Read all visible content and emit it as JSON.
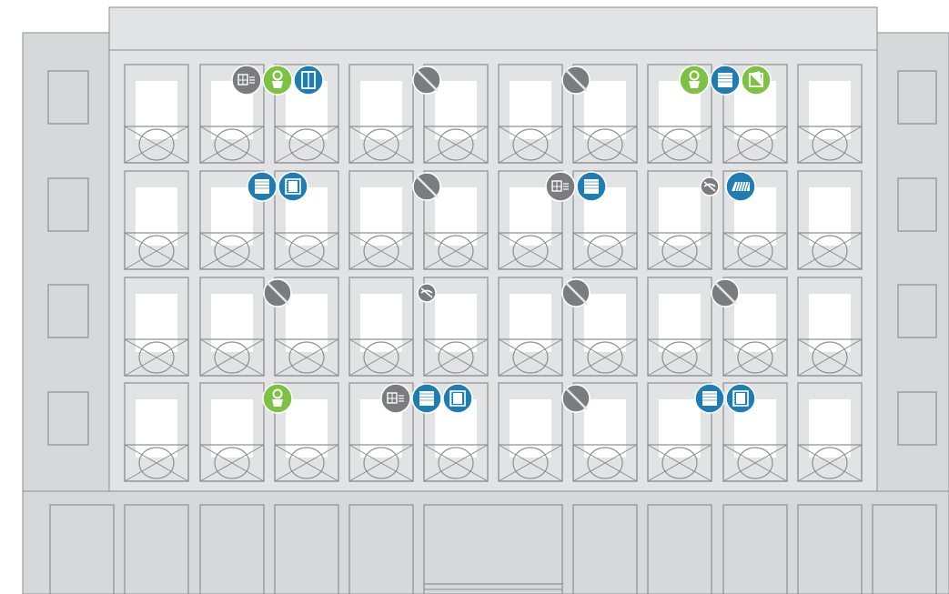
{
  "building": {
    "floors": 4,
    "window_columns": 10,
    "side_windows_per_side": 4,
    "ground_panels": 10
  },
  "colors": {
    "facade": "#e2e3e5",
    "facade_side": "#d7d8da",
    "line": "#8c8e91",
    "glass": "#ffffff",
    "green": "#7dc242",
    "blue": "#1f7db3",
    "gray": "#7a7c7f"
  },
  "markers": [
    {
      "floor": 1,
      "col": 2,
      "icons": [
        {
          "type": "gray",
          "icon": "roller-shutter-icon"
        },
        {
          "type": "green",
          "icon": "plant-sensor-icon"
        },
        {
          "type": "blue",
          "icon": "door-sensor-icon"
        }
      ]
    },
    {
      "floor": 1,
      "col": 4,
      "icons": [
        {
          "type": "gray-disabled",
          "icon": "not-connected-icon"
        }
      ]
    },
    {
      "floor": 1,
      "col": 6,
      "icons": [
        {
          "type": "gray-disabled",
          "icon": "not-connected-icon"
        }
      ]
    },
    {
      "floor": 1,
      "col": 8,
      "icons": [
        {
          "type": "green",
          "icon": "plant-sensor-icon"
        },
        {
          "type": "blue",
          "icon": "window-blind-icon"
        },
        {
          "type": "green",
          "icon": "window-tilt-icon"
        }
      ]
    },
    {
      "floor": 2,
      "col": 2,
      "icons": [
        {
          "type": "blue",
          "icon": "window-blind-icon"
        },
        {
          "type": "blue",
          "icon": "curtain-icon"
        }
      ]
    },
    {
      "floor": 2,
      "col": 4,
      "icons": [
        {
          "type": "gray-disabled",
          "icon": "not-connected-icon"
        }
      ]
    },
    {
      "floor": 2,
      "col": 6,
      "icons": [
        {
          "type": "gray",
          "icon": "roller-shutter-icon"
        },
        {
          "type": "blue",
          "icon": "window-blind-icon"
        }
      ]
    },
    {
      "floor": 2,
      "col": 8,
      "icons": [
        {
          "type": "gray-small",
          "icon": "no-signal-icon"
        },
        {
          "type": "blue",
          "icon": "awning-icon"
        }
      ]
    },
    {
      "floor": 3,
      "col": 2,
      "icons": [
        {
          "type": "gray-disabled",
          "icon": "not-connected-icon"
        }
      ]
    },
    {
      "floor": 3,
      "col": 4,
      "icons": [
        {
          "type": "gray-small",
          "icon": "no-signal-icon"
        }
      ]
    },
    {
      "floor": 3,
      "col": 6,
      "icons": [
        {
          "type": "gray-disabled",
          "icon": "not-connected-icon"
        }
      ]
    },
    {
      "floor": 3,
      "col": 8,
      "icons": [
        {
          "type": "gray-disabled",
          "icon": "not-connected-icon"
        }
      ]
    },
    {
      "floor": 4,
      "col": 2,
      "icons": [
        {
          "type": "green",
          "icon": "plant-sensor-icon"
        }
      ]
    },
    {
      "floor": 4,
      "col": 4,
      "icons": [
        {
          "type": "gray",
          "icon": "roller-shutter-icon"
        },
        {
          "type": "blue",
          "icon": "window-blind-icon"
        },
        {
          "type": "blue",
          "icon": "curtain-icon"
        }
      ]
    },
    {
      "floor": 4,
      "col": 6,
      "icons": [
        {
          "type": "gray-disabled",
          "icon": "not-connected-icon"
        }
      ]
    },
    {
      "floor": 4,
      "col": 8,
      "icons": [
        {
          "type": "blue",
          "icon": "window-blind-icon"
        },
        {
          "type": "blue",
          "icon": "curtain-icon"
        }
      ]
    }
  ]
}
